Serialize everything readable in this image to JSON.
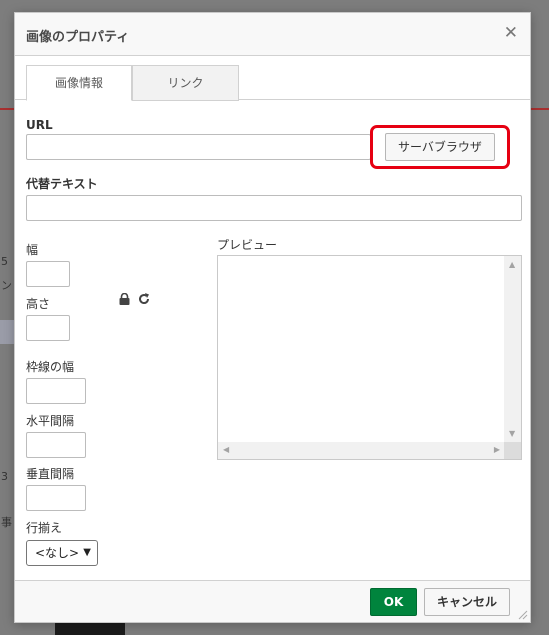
{
  "background": {
    "fragment_1": "5",
    "fragment_2": "ン",
    "fragment_3": "3",
    "fragment_4": "事"
  },
  "dialog": {
    "title": "画像のプロパティ",
    "close_glyph": "✕"
  },
  "tabs": [
    {
      "label": "画像情報",
      "active": true
    },
    {
      "label": "リンク",
      "active": false
    }
  ],
  "form": {
    "url_label": "URL",
    "url_value": "",
    "browse_button_label": "サーバブラウザ",
    "alt_label": "代替テキスト",
    "alt_value": "",
    "width_label": "幅",
    "width_value": "",
    "height_label": "高さ",
    "height_value": "",
    "border_label": "枠線の幅",
    "border_value": "",
    "hspace_label": "水平間隔",
    "hspace_value": "",
    "vspace_label": "垂直間隔",
    "vspace_value": "",
    "align_label": "行揃え",
    "align_selected": "<なし>",
    "preview_label": "プレビュー"
  },
  "footer": {
    "ok_label": "OK",
    "cancel_label": "キャンセル"
  },
  "colors": {
    "ok_button": "#00843d",
    "highlight": "#e60012"
  }
}
